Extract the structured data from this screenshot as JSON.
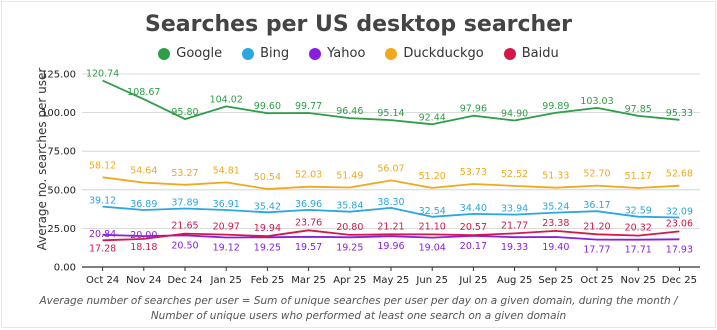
{
  "chart_data": {
    "type": "line",
    "title": "Searches per US desktop searcher",
    "ylabel": "Average no. searches per user",
    "xlabel": "",
    "categories": [
      "Oct 24",
      "Nov 24",
      "Dec 24",
      "Jan 25",
      "Feb 25",
      "Mar 25",
      "Apr 25",
      "May 25",
      "Jun 25",
      "Jul 25",
      "Aug 25",
      "Sep 25",
      "Oct 25",
      "Nov 25",
      "Dec 25"
    ],
    "ylim": [
      0,
      125
    ],
    "yticks": [
      "0.00",
      "25.00",
      "50.00",
      "75.00",
      "100.00",
      "125.00"
    ],
    "grid": true,
    "legend_position": "top",
    "series": [
      {
        "name": "Google",
        "color": "#2e9e49",
        "values": [
          120.74,
          108.67,
          95.8,
          104.02,
          99.6,
          99.77,
          96.46,
          95.14,
          92.44,
          97.96,
          94.9,
          99.89,
          103.03,
          97.85,
          95.33
        ],
        "labels": [
          "120.74",
          "108.67",
          "95.80",
          "104.02",
          "99.60",
          "99.77",
          "96.46",
          "95.14",
          "92.44",
          "97.96",
          "94.90",
          "99.89",
          "103.03",
          "97.85",
          "95.33"
        ]
      },
      {
        "name": "Bing",
        "color": "#2aa6e0",
        "values": [
          39.12,
          36.89,
          37.89,
          36.91,
          35.42,
          36.96,
          35.84,
          38.3,
          32.54,
          34.4,
          33.94,
          35.24,
          36.17,
          32.59,
          32.09
        ],
        "labels": [
          "39.12",
          "36.89",
          "37.89",
          "36.91",
          "35.42",
          "36.96",
          "35.84",
          "38.30",
          "32.54",
          "34.40",
          "33.94",
          "35.24",
          "36.17",
          "32.59",
          "32.09"
        ]
      },
      {
        "name": "Yahoo",
        "color": "#8a1ee0",
        "values": [
          20.84,
          20.0,
          20.5,
          19.12,
          19.25,
          19.57,
          19.25,
          19.96,
          19.04,
          20.17,
          19.33,
          19.4,
          17.77,
          17.71,
          17.93
        ],
        "labels": [
          "20.84",
          "20.00",
          "20.50",
          "19.12",
          "19.25",
          "19.57",
          "19.25",
          "19.96",
          "19.04",
          "20.17",
          "19.33",
          "19.40",
          "17.77",
          "17.71",
          "17.93"
        ]
      },
      {
        "name": "Duckduckgo",
        "color": "#f0a91e",
        "values": [
          58.12,
          54.64,
          53.27,
          54.81,
          50.54,
          52.03,
          51.49,
          56.07,
          51.2,
          53.73,
          52.52,
          51.33,
          52.7,
          51.17,
          52.68
        ],
        "labels": [
          "58.12",
          "54.64",
          "53.27",
          "54.81",
          "50.54",
          "52.03",
          "51.49",
          "56.07",
          "51.20",
          "53.73",
          "52.52",
          "51.33",
          "52.70",
          "51.17",
          "52.68"
        ]
      },
      {
        "name": "Baidu",
        "color": "#d4184a",
        "values": [
          17.28,
          18.18,
          21.65,
          20.97,
          19.94,
          23.76,
          20.8,
          21.21,
          21.1,
          20.57,
          21.77,
          23.38,
          21.2,
          20.32,
          23.06
        ],
        "labels": [
          "17.28",
          "18.18",
          "21.65",
          "20.97",
          "19.94",
          "23.76",
          "20.80",
          "21.21",
          "21.10",
          "20.57",
          "21.77",
          "23.38",
          "21.20",
          "20.32",
          "23.06"
        ]
      }
    ]
  },
  "footnote": {
    "line1": "Average number of searches per user = Sum of unique searches per user per day on a given domain, during the month /",
    "line2": "Number of unique users who performed at least one search on a given domain"
  }
}
